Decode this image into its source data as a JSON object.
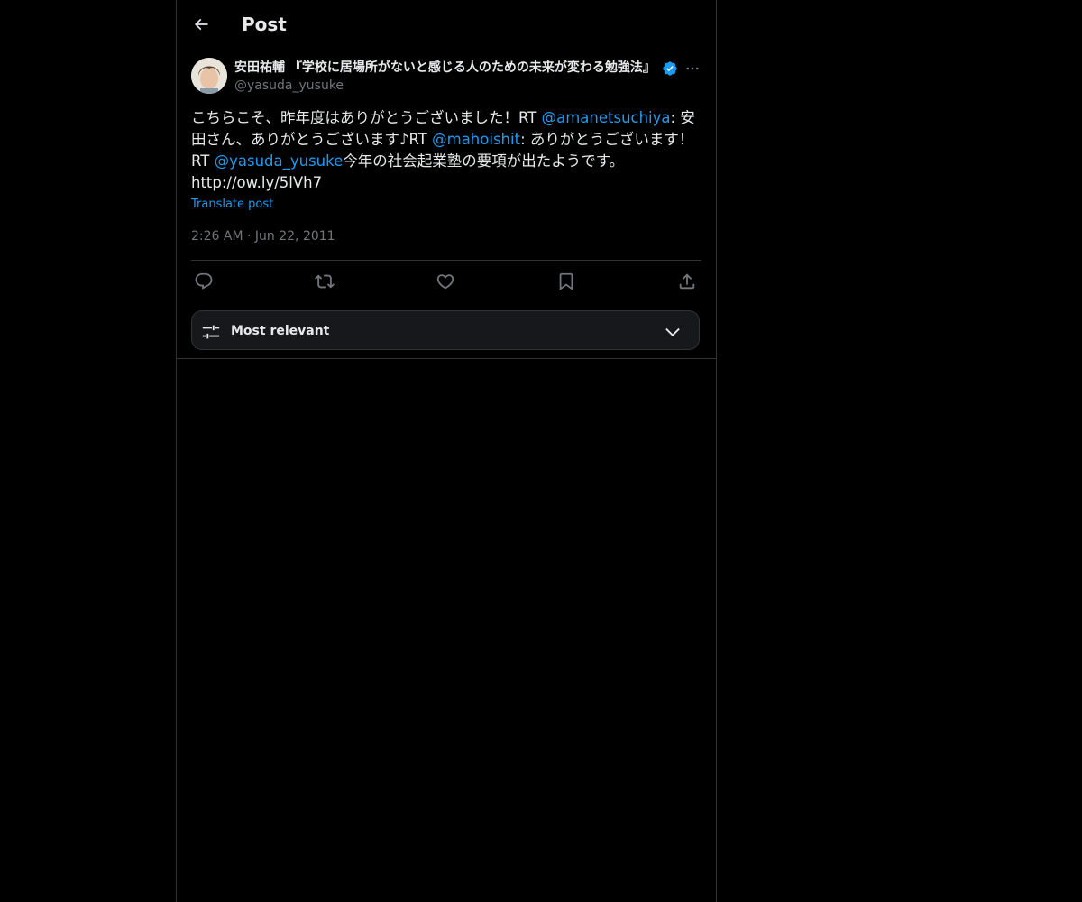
{
  "header": {
    "title": "Post",
    "back_icon": "arrow-left-icon"
  },
  "author": {
    "display_name": "安田祐輔 『学校に居場所がないと感じる人のための未来が変わる勉強法』",
    "handle": "@yasuda_yusuke",
    "verified": true,
    "verified_color": "#1d9bf0",
    "more_icon": "more-horizontal-icon"
  },
  "tweet": {
    "text_segments": [
      {
        "text": "こちらこそ、昨年度はありがとうございました！RT ",
        "type": "text"
      },
      {
        "text": "@amanetsuchiya",
        "type": "mention"
      },
      {
        "text": ": 安田さん、ありがとうございます♪RT ",
        "type": "text"
      },
      {
        "text": "@mahoishit",
        "type": "mention"
      },
      {
        "text": ": ありがとうございます！ RT ",
        "type": "text"
      },
      {
        "text": "@yasuda_yusuke",
        "type": "mention"
      },
      {
        "text": "今年の社会起業塾の要項が出たようです。",
        "type": "text"
      },
      {
        "text": "http://ow.ly/5lVh7",
        "type": "text"
      }
    ],
    "translate_label": "Translate post",
    "time": "2:26 AM",
    "date_separator": "·",
    "date": "Jun 22, 2011"
  },
  "actions": [
    {
      "name": "reply",
      "icon": "reply-icon"
    },
    {
      "name": "repost",
      "icon": "repost-icon"
    },
    {
      "name": "like",
      "icon": "heart-icon"
    },
    {
      "name": "bookmark",
      "icon": "bookmark-icon"
    },
    {
      "name": "share",
      "icon": "share-icon"
    }
  ],
  "sort": {
    "label": "Most relevant",
    "icon": "sliders-icon",
    "chevron": "chevron-down-icon"
  },
  "colors": {
    "background": "#000000",
    "text": "#e7e9ea",
    "secondary": "#71767b",
    "accent": "#1d9bf0",
    "border": "#2f3336"
  }
}
